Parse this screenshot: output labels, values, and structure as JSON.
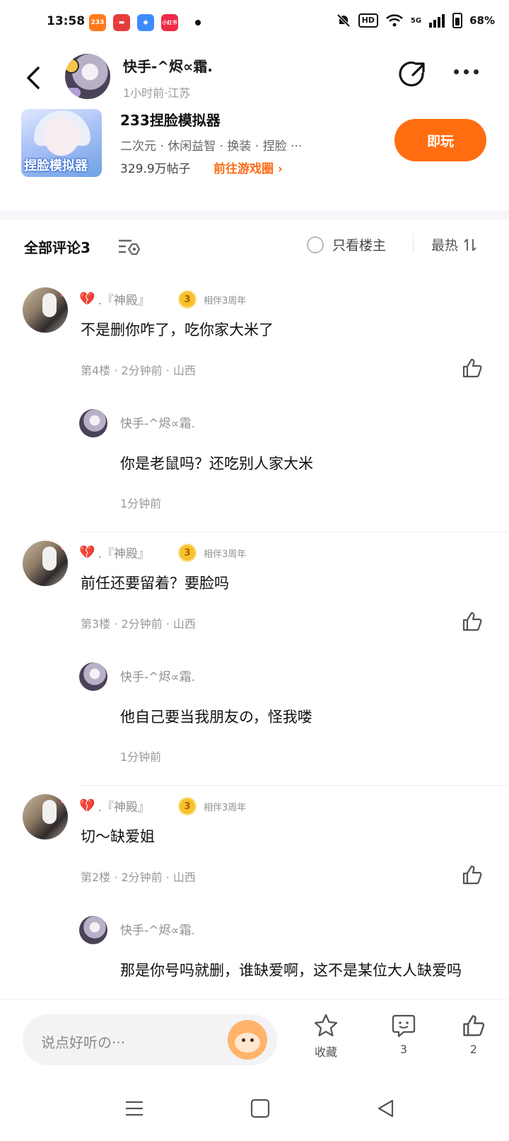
{
  "status_bar": {
    "time": "13:58",
    "apps": [
      "233",
      "红包",
      "小程序",
      "小红书"
    ],
    "network": "5G",
    "hd": "HD",
    "battery": "68%"
  },
  "header": {
    "author_name": "快手-^烬∝霜.",
    "author_meta": "1小时前·江苏",
    "game": {
      "title": "233捏脸模拟器",
      "tags": "二次元 · 休闲益智 · 换装 · 捏脸 ···",
      "posts": "329.9万帖子",
      "link": "前往游戏圈 ›",
      "play_label": "即玩",
      "image_logo": "捏脸模拟器"
    }
  },
  "comments_bar": {
    "title": "全部评论3",
    "owner_only": "只看楼主",
    "sort": "最热"
  },
  "threads": [
    {
      "name": ".『神殿』",
      "medal": "3",
      "medal_text": "相伴3周年",
      "text": "不是删你咋了，吃你家大米了",
      "meta": "第4楼 · 2分钟前 · 山西",
      "reply": {
        "name": "快手-^烬∝霜.",
        "text": "你是老鼠吗？还吃别人家大米",
        "time": "1分钟前"
      }
    },
    {
      "name": ".『神殿』",
      "medal": "3",
      "medal_text": "相伴3周年",
      "text": "前任还要留着？要脸吗",
      "meta": "第3楼 · 2分钟前 · 山西",
      "reply": {
        "name": "快手-^烬∝霜.",
        "text": "他自己要当我朋友の，怪我喽",
        "time": "1分钟前"
      }
    },
    {
      "name": ".『神殿』",
      "medal": "3",
      "medal_text": "相伴3周年",
      "text": "切～缺爱姐",
      "meta": "第2楼 · 2分钟前 · 山西",
      "reply": {
        "name": "快手-^烬∝霜.",
        "text": "那是你号吗就删，谁缺爱啊，这不是某位大人缺爱吗",
        "time": ""
      }
    }
  ],
  "bottom_bar": {
    "placeholder": "说点好听の···",
    "favorite_label": "收藏",
    "comment_count": "3",
    "like_count": "2"
  },
  "icons": {
    "back": "back-arrow-icon",
    "share": "share-icon",
    "more": "more-icon",
    "like": "thumbs-up-icon",
    "star": "star-icon",
    "comment": "comment-icon"
  },
  "colors": {
    "accent": "#ff6d10",
    "link": "#ff6a13",
    "medal": "#f6c22d"
  }
}
